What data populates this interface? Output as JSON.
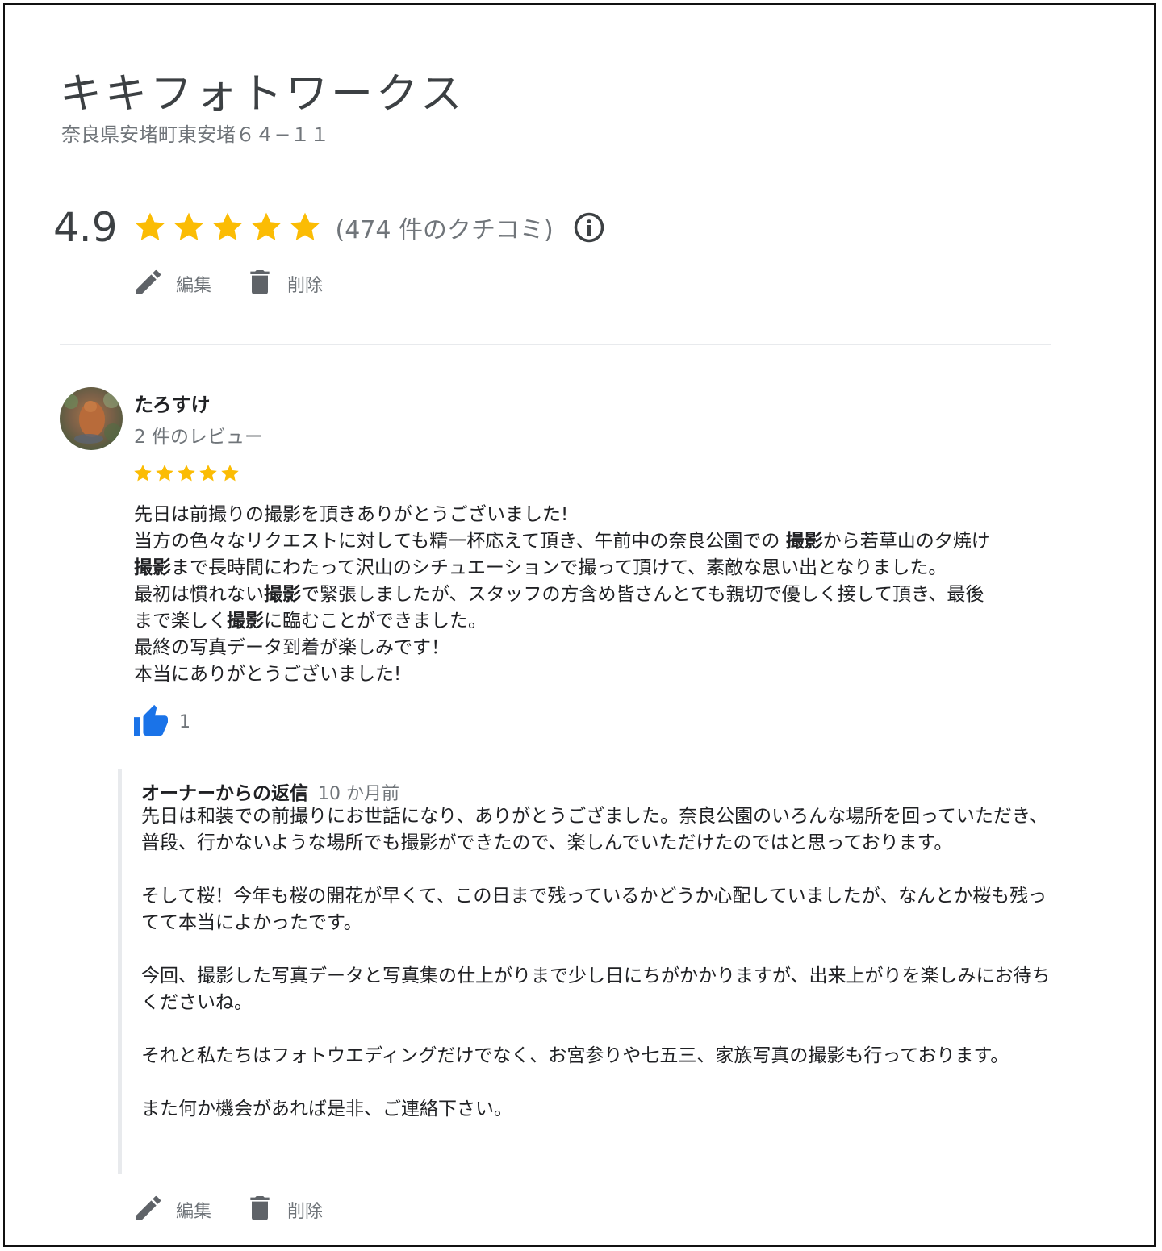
{
  "business": {
    "name": "キキフォトワークス",
    "address": "奈良県安堵町東安堵６４−１１"
  },
  "rating": {
    "value": "4.9",
    "stars": 5,
    "count_text": "(474 件のクチコミ)",
    "info_icon": "info-icon",
    "star_color": "#fbbc04"
  },
  "top_actions": {
    "edit_label": "編集",
    "delete_label": "削除"
  },
  "review": {
    "author": "たろすけ",
    "meta": "2 件のレビュー",
    "stars": 5,
    "lines": [
      {
        "parts": [
          {
            "t": "先日は前撮りの撮影を頂きありがとうございました!"
          }
        ]
      },
      {
        "parts": [
          {
            "t": "当方の色々なリクエストに対しても精一杯応えて頂き、午前中の奈良公園での "
          },
          {
            "t": "撮影",
            "b": true
          },
          {
            "t": "から若草山の夕焼け"
          }
        ]
      },
      {
        "parts": [
          {
            "t": "撮影",
            "b": true
          },
          {
            "t": "まで長時間にわたって沢山のシチュエーションで撮って頂けて、素敵な思い出となりました。"
          }
        ]
      },
      {
        "parts": [
          {
            "t": "最初は慣れない"
          },
          {
            "t": "撮影",
            "b": true
          },
          {
            "t": "で緊張しましたが、スタッフの方含め皆さんとても親切で優しく接して頂き、最後"
          }
        ]
      },
      {
        "parts": [
          {
            "t": "まで楽しく"
          },
          {
            "t": "撮影",
            "b": true
          },
          {
            "t": "に臨むことができました。"
          }
        ]
      },
      {
        "parts": [
          {
            "t": "最終の写真データ到着が楽しみです！"
          }
        ]
      },
      {
        "parts": [
          {
            "t": "本当にありがとうございました!"
          }
        ]
      }
    ],
    "like_count": "1",
    "like_color": "#1a73e8"
  },
  "owner_reply": {
    "title": "オーナーからの返信",
    "time": "10 か月前",
    "paragraphs": [
      "先日は和装での前撮りにお世話になり、ありがとうござました。奈良公園のいろんな場所を回っていただき、普段、行かないような場所でも撮影ができたので、楽しんでいただけたのではと思っております。",
      "そして桜！今年も桜の開花が早くて、この日まで残っているかどうか心配していましたが、なんとか桜も残ってて本当によかったです。",
      "今回、撮影した写真データと写真集の仕上がりまで少し日にちがかかりますが、出来上がりを楽しみにお待ちくださいね。",
      "それと私たちはフォトウエディングだけでなく、お宮参りや七五三、家族写真の撮影も行っております。",
      "また何か機会があれば是非、ご連絡下さい。"
    ]
  },
  "bottom_actions": {
    "edit_label": "編集",
    "delete_label": "削除"
  }
}
